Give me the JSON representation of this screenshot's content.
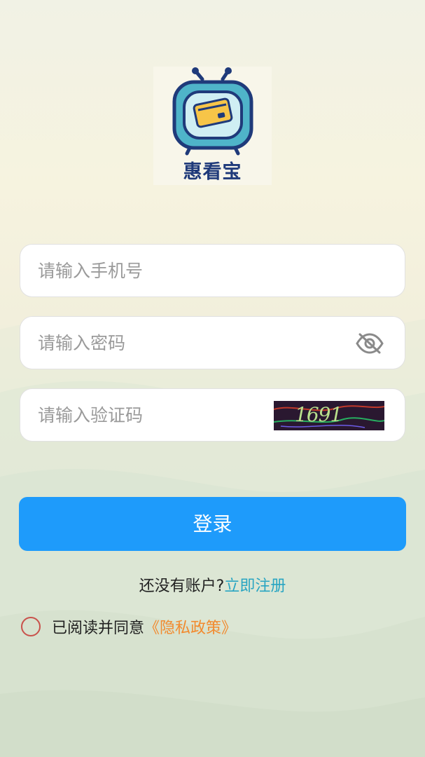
{
  "app": {
    "logo_text": "惠看宝"
  },
  "form": {
    "phone_placeholder": "请输入手机号",
    "password_placeholder": "请输入密码",
    "captcha_placeholder": "请输入验证码",
    "captcha_image_text": "1691"
  },
  "actions": {
    "login_label": "登录",
    "no_account_text": "还没有账户?",
    "register_label": "立即注册"
  },
  "agreement": {
    "text": "已阅读并同意",
    "policy_label": "《隐私政策》"
  },
  "colors": {
    "primary": "#1e9bfb",
    "register_link": "#29a5c2",
    "policy_link": "#f28a2e",
    "radio_border": "#c9524c"
  }
}
